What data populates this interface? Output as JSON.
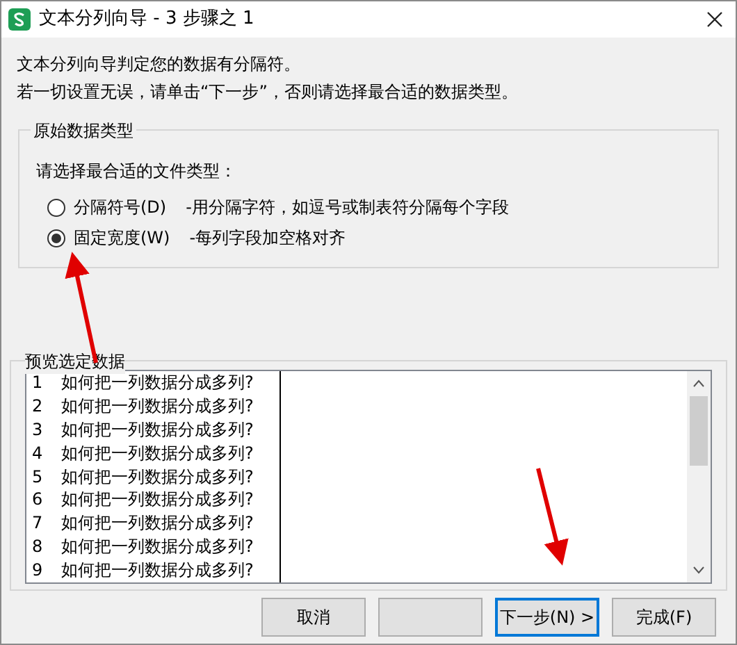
{
  "window": {
    "title": "文本分列向导 - 3 步骤之 1"
  },
  "intro": [
    "文本分列向导判定您的数据有分隔符。",
    "若一切设置无误，请单击“下一步”，否则请选择最合适的数据类型。"
  ],
  "group": {
    "title": "原始数据类型",
    "prompt": "请选择最合适的文件类型：",
    "options": [
      {
        "label": "分隔符号(D)",
        "description": "-用分隔字符，如逗号或制表符分隔每个字段",
        "selected": false
      },
      {
        "label": "固定宽度(W)",
        "description": "-每列字段加空格对齐",
        "selected": true
      }
    ]
  },
  "preview": {
    "title": "预览选定数据",
    "rows": [
      {
        "number": "1",
        "text": "如何把一列数据分成多列?"
      },
      {
        "number": "2",
        "text": "如何把一列数据分成多列?"
      },
      {
        "number": "3",
        "text": "如何把一列数据分成多列?"
      },
      {
        "number": "4",
        "text": "如何把一列数据分成多列?"
      },
      {
        "number": "5",
        "text": "如何把一列数据分成多列?"
      },
      {
        "number": "6",
        "text": "如何把一列数据分成多列?"
      },
      {
        "number": "7",
        "text": "如何把一列数据分成多列?"
      },
      {
        "number": "8",
        "text": "如何把一列数据分成多列?"
      },
      {
        "number": "9",
        "text": "如何把一列数据分成多列?"
      }
    ]
  },
  "buttons": [
    {
      "kind": "text",
      "label": "取消",
      "default": false
    },
    {
      "kind": "blank",
      "default": false
    },
    {
      "kind": "text",
      "label": "下一步(N) >",
      "default": true
    },
    {
      "kind": "text",
      "label": "完成(F)",
      "default": false
    }
  ]
}
